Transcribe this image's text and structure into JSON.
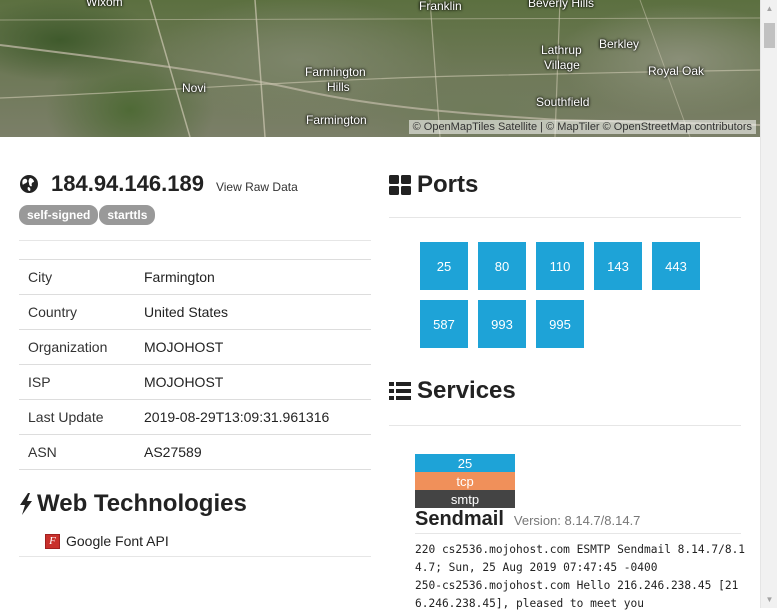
{
  "map": {
    "labels": [
      "Wixom",
      "Franklin",
      "Beverly Hills",
      "Lathrup",
      "Village",
      "Berkley",
      "Novi",
      "Farmington",
      "Hills",
      "Royal Oak",
      "Southfield",
      "Farmington"
    ],
    "attribution": "© OpenMapTiles Satellite | © MapTiler © OpenStreetMap contributors"
  },
  "host": {
    "ip": "184.94.146.189",
    "raw_link": "View Raw Data",
    "tags": [
      "self-signed",
      "starttls"
    ]
  },
  "info": [
    {
      "key": "City",
      "value": "Farmington"
    },
    {
      "key": "Country",
      "value": "United States"
    },
    {
      "key": "Organization",
      "value": "MOJOHOST"
    },
    {
      "key": "ISP",
      "value": "MOJOHOST"
    },
    {
      "key": "Last Update",
      "value": "2019-08-29T13:09:31.961316"
    },
    {
      "key": "ASN",
      "value": "AS27589"
    }
  ],
  "web_tech": {
    "title": "Web Technologies",
    "items": [
      "Google Font API"
    ]
  },
  "ports": {
    "title": "Ports",
    "list": [
      "25",
      "80",
      "110",
      "143",
      "443",
      "587",
      "993",
      "995"
    ]
  },
  "services": {
    "title": "Services",
    "port": "25",
    "transport": "tcp",
    "protocol": "smtp",
    "name": "Sendmail",
    "version": "Version: 8.14.7/8.14.7",
    "banner": [
      "220 cs2536.mojohost.com ESMTP Sendmail 8.14.7/8.1",
      "4.7; Sun, 25 Aug 2019 07:47:45 -0400",
      "250-cs2536.mojohost.com Hello 216.246.238.45 [21",
      "6.246.238.45], pleased to meet you"
    ]
  },
  "colors": {
    "port_tile": "#1ea3d7",
    "tcp": "#f0905a",
    "protocol": "#444444",
    "tag": "#999999"
  }
}
